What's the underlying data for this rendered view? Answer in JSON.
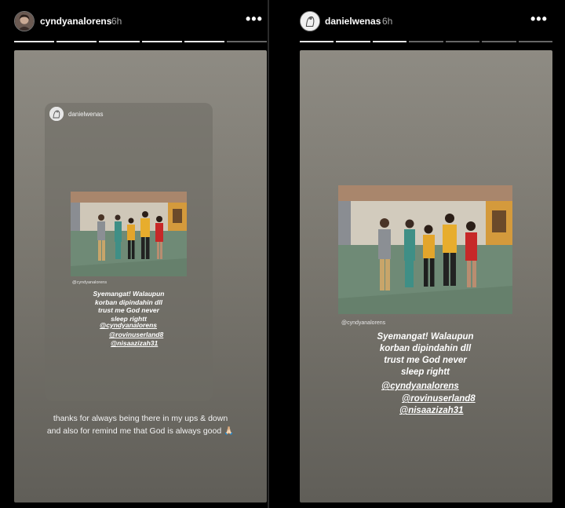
{
  "left": {
    "username": "cyndyanalorens",
    "time": "6h",
    "progress_segments": 6,
    "progress_done": 5,
    "card": {
      "username": "danielwenas",
      "credit": "@cyndyanalorens",
      "caption_lines": [
        "Syemangat! Walaupun",
        "korban dipindahin dll",
        "trust me God never",
        "sleep rightt"
      ],
      "mentions": [
        "@cyndyanalorens",
        "@rovinuserland8",
        "@nisaazizah31"
      ]
    },
    "reply_lines": [
      "thanks for always being there in my ups & down",
      "and also for remind me that God is always good 🙏🏻"
    ]
  },
  "right": {
    "username": "danielwenas",
    "time": "6h",
    "progress_segments": 7,
    "progress_done": 3,
    "credit": "@cyndyanalorens",
    "caption_lines": [
      "Syemangat! Walaupun",
      "korban dipindahin dll",
      "trust me God never",
      "sleep rightt"
    ],
    "mentions": [
      "@cyndyanalorens",
      "@rovinuserland8",
      "@nisaazizah31"
    ]
  },
  "icons": {
    "more": "more-options-icon",
    "avatar": "profile-avatar-icon"
  },
  "colors": {
    "story_bg": "#7a776f",
    "progress_active": "#e8e8e8",
    "progress_inactive": "#666666"
  }
}
